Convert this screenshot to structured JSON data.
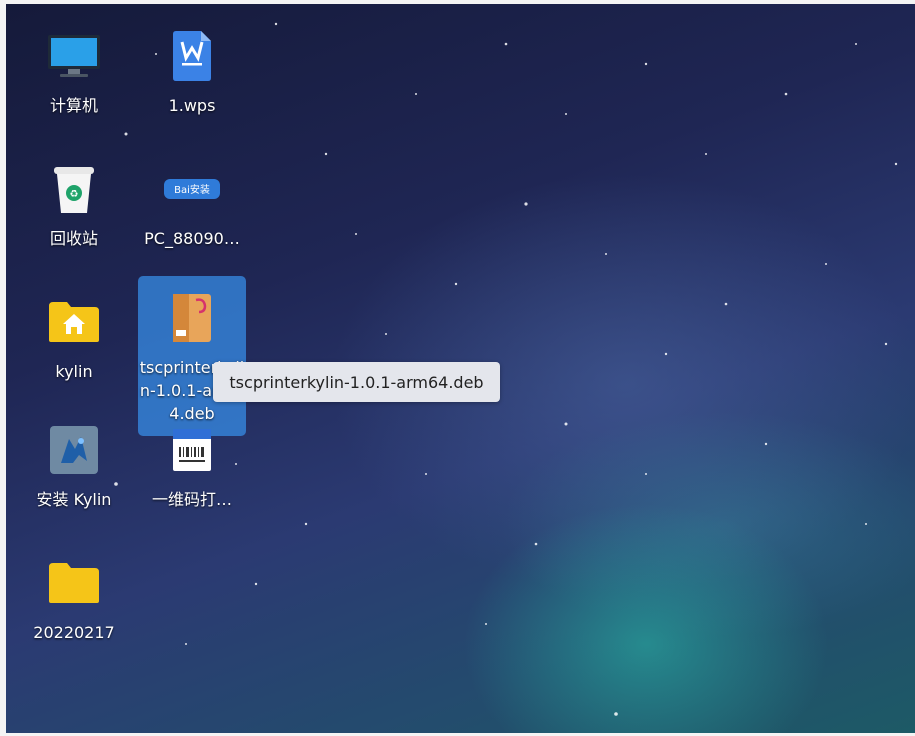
{
  "desktop_icons": [
    {
      "label": "计算机",
      "icon": "computer-icon"
    },
    {
      "label": "1.wps",
      "icon": "wps-document-icon"
    },
    {
      "label": "回收站",
      "icon": "trash-icon"
    },
    {
      "label": "PC_88090…",
      "icon": "baidu-installer-icon"
    },
    {
      "label": "kylin",
      "icon": "home-folder-icon"
    },
    {
      "label": "tscprinterkylin-1.0.1-arm64.deb",
      "icon": "deb-package-icon",
      "selected": true
    },
    {
      "label": "安装 Kylin",
      "icon": "kylin-installer-icon"
    },
    {
      "label": "一维码打…",
      "icon": "barcode-app-icon"
    },
    {
      "label": "20220217",
      "icon": "folder-icon"
    }
  ],
  "tooltip": {
    "text": "tscprinterkylin-1.0.1-arm64.deb"
  },
  "icon_badge_texts": {
    "baidu": "Bai安装"
  },
  "colors": {
    "selection": "#378ce6",
    "tooltip_bg": "#e4e6ec",
    "folder": "#f5c518"
  }
}
